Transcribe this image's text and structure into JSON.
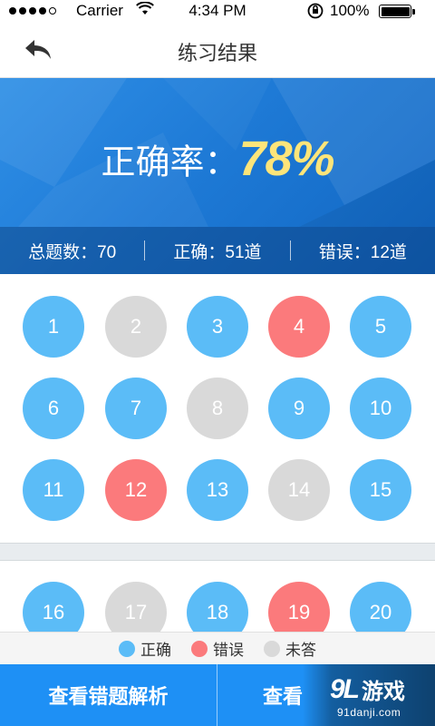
{
  "status_bar": {
    "carrier": "Carrier",
    "time": "4:34 PM",
    "battery": "100%"
  },
  "nav": {
    "title": "练习结果",
    "back_icon": "back-arrow-icon"
  },
  "summary": {
    "accuracy_label": "正确率：",
    "accuracy_value": "78%",
    "total": "总题数：70",
    "correct": "正确：51道",
    "wrong": "错误：12道"
  },
  "questions": [
    {
      "n": "1",
      "state": "correct"
    },
    {
      "n": "2",
      "state": "none"
    },
    {
      "n": "3",
      "state": "correct"
    },
    {
      "n": "4",
      "state": "wrong"
    },
    {
      "n": "5",
      "state": "correct"
    },
    {
      "n": "6",
      "state": "correct"
    },
    {
      "n": "7",
      "state": "correct"
    },
    {
      "n": "8",
      "state": "none"
    },
    {
      "n": "9",
      "state": "correct"
    },
    {
      "n": "10",
      "state": "correct"
    },
    {
      "n": "11",
      "state": "correct"
    },
    {
      "n": "12",
      "state": "wrong"
    },
    {
      "n": "13",
      "state": "correct"
    },
    {
      "n": "14",
      "state": "none"
    },
    {
      "n": "15",
      "state": "correct"
    }
  ],
  "questions_partial": [
    {
      "n": "16",
      "state": "correct"
    },
    {
      "n": "17",
      "state": "none"
    },
    {
      "n": "18",
      "state": "correct"
    },
    {
      "n": "19",
      "state": "wrong"
    },
    {
      "n": "20",
      "state": "correct"
    }
  ],
  "legend": {
    "correct": "正确",
    "wrong": "错误",
    "none": "未答"
  },
  "colors": {
    "correct": "#5bbcf7",
    "wrong": "#fb7a7c",
    "none": "#d9d9d9",
    "accent": "#1e90f5",
    "highlight": "#fde57a"
  },
  "buttons": {
    "view_wrong": "查看错题解析",
    "view_all": "查看"
  },
  "watermark": {
    "mark": "9L",
    "name": "游戏",
    "url": "91danji.com"
  }
}
